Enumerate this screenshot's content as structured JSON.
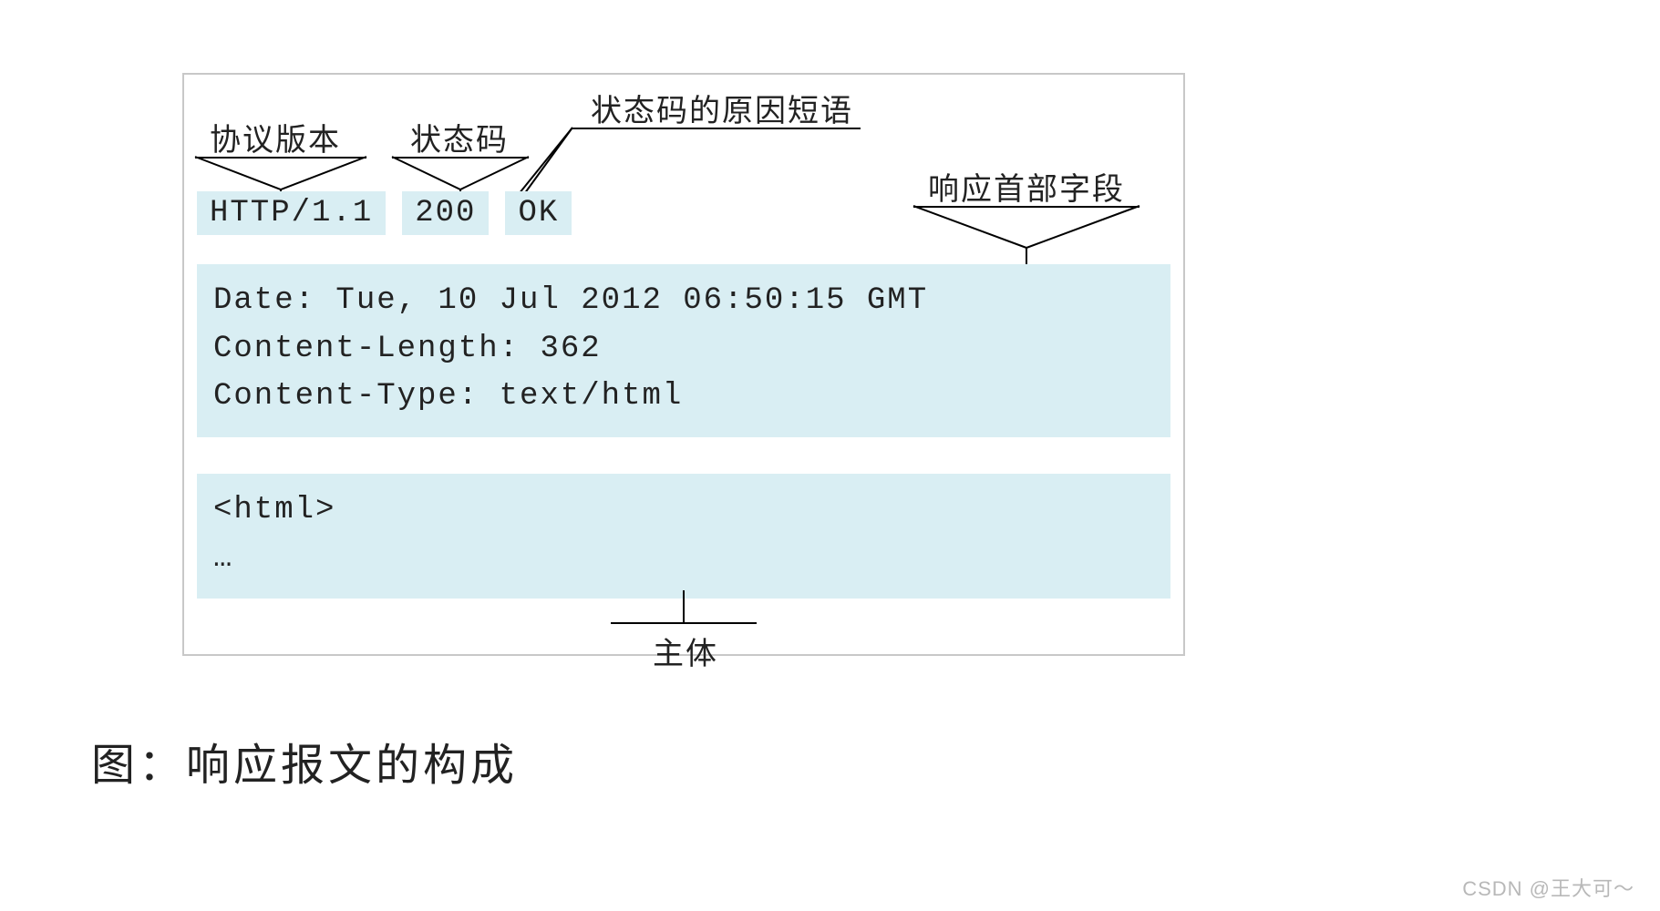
{
  "annotations": {
    "protocol_version": "协议版本",
    "status_code": "状态码",
    "reason_phrase": "状态码的原因短语",
    "response_headers": "响应首部字段",
    "body": "主体"
  },
  "status_line": {
    "protocol": "HTTP/1.1",
    "code": "200",
    "reason": "OK"
  },
  "headers": {
    "line1": "Date: Tue, 10 Jul 2012 06:50:15 GMT",
    "line2": "Content-Length: 362",
    "line3": "Content-Type: text/html"
  },
  "body": {
    "line1": "<html>",
    "line2": "…"
  },
  "caption": "图：响应报文的构成",
  "watermark": "CSDN @王大可～"
}
